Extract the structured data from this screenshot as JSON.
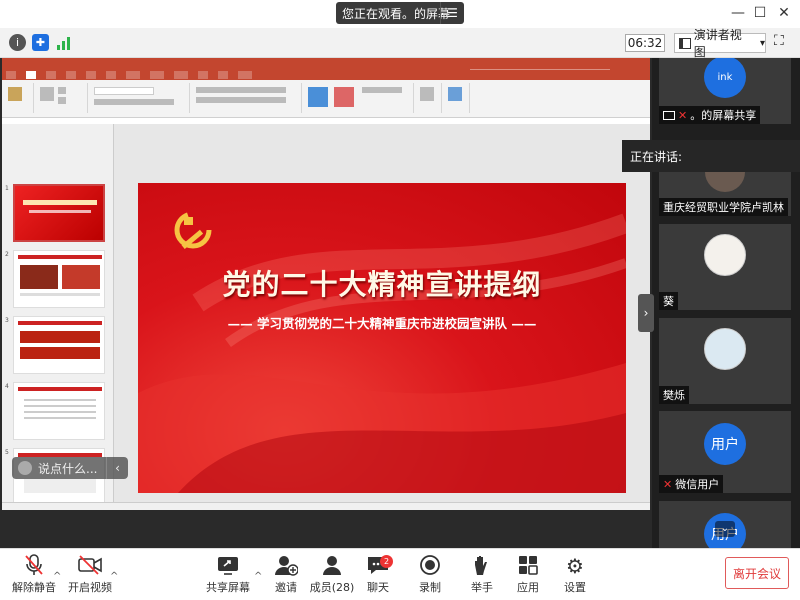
{
  "top": {
    "viewing_text": "您正在观看。的屏幕",
    "minimize": "—",
    "maximize": "☐",
    "close": "✕"
  },
  "toolbar": {
    "timer": "06:32",
    "view_button": "演讲者视图",
    "view_caret": "▾",
    "fullscreen": "⛶"
  },
  "slide": {
    "title": "党的二十大精神宣讲提纲",
    "subtitle": "—— 学习贯彻党的二十大精神重庆市进校园宣讲队 ——"
  },
  "thumbnails": [
    {
      "num": "1"
    },
    {
      "num": "2"
    },
    {
      "num": "3"
    },
    {
      "num": "4"
    },
    {
      "num": "5"
    }
  ],
  "chat_hint": {
    "placeholder": "说点什么...",
    "caret": "‹"
  },
  "speaking": {
    "label": "正在讲话:"
  },
  "participants": [
    {
      "name": "。的屏幕共享",
      "avatar": "ink"
    },
    {
      "name": "重庆经贸职业学院卢凯林",
      "avatar": "photo"
    },
    {
      "name": "葵",
      "avatar": "drawing"
    },
    {
      "name": "樊烁",
      "avatar": "cartoon"
    },
    {
      "name": "微信用户",
      "avatar_text": "用户"
    },
    {
      "name": "",
      "avatar_text": "用户"
    }
  ],
  "controls": {
    "mute": "解除静音",
    "video": "开启视频",
    "share": "共享屏幕",
    "invite": "邀请",
    "members": "成员(28)",
    "chat": "聊天",
    "chat_badge": "2",
    "record": "录制",
    "raise_hand": "举手",
    "apps": "应用",
    "settings": "设置",
    "leave": "离开会议"
  },
  "colors": {
    "accent": "#1e6fe0",
    "slide_red": "#d9141a",
    "leave_red": "#e03b3b"
  }
}
